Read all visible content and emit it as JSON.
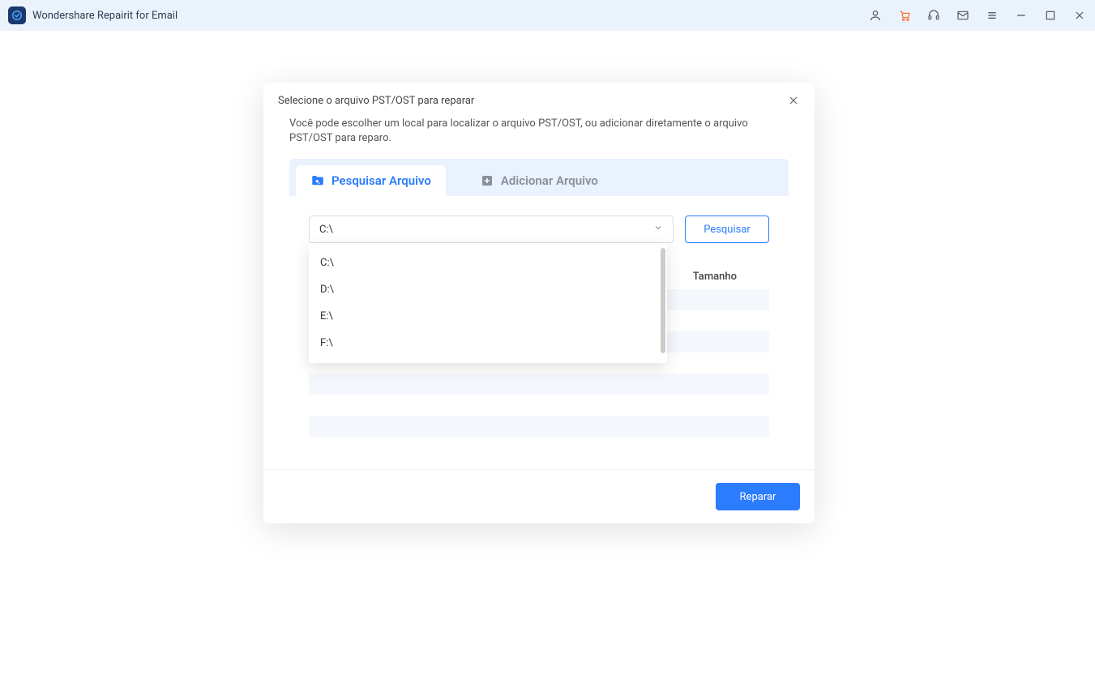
{
  "app": {
    "title": "Wondershare Repairit for Email"
  },
  "titlebar_icons": {
    "user": "user-icon",
    "cart": "cart-icon",
    "headset": "headset-icon",
    "mail": "mail-icon",
    "menu": "menu-icon",
    "minimize": "minimize-icon",
    "maximize": "maximize-icon",
    "close": "close-icon"
  },
  "dialog": {
    "title": "Selecione o arquivo PST/OST para reparar",
    "description": "Você pode escolher um local para localizar o arquivo PST/OST, ou adicionar diretamente o arquivo PST/OST para reparo.",
    "tabs": {
      "search": "Pesquisar Arquivo",
      "add": "Adicionar Arquivo"
    },
    "drive_selected": "C:\\",
    "drive_options": [
      "C:\\",
      "D:\\",
      "E:\\",
      "F:\\"
    ],
    "search_button": "Pesquisar",
    "table": {
      "col_size": "Tamanho"
    },
    "repair_button": "Reparar"
  },
  "colors": {
    "accent": "#2b7cff",
    "cart": "#ff6a2b"
  }
}
